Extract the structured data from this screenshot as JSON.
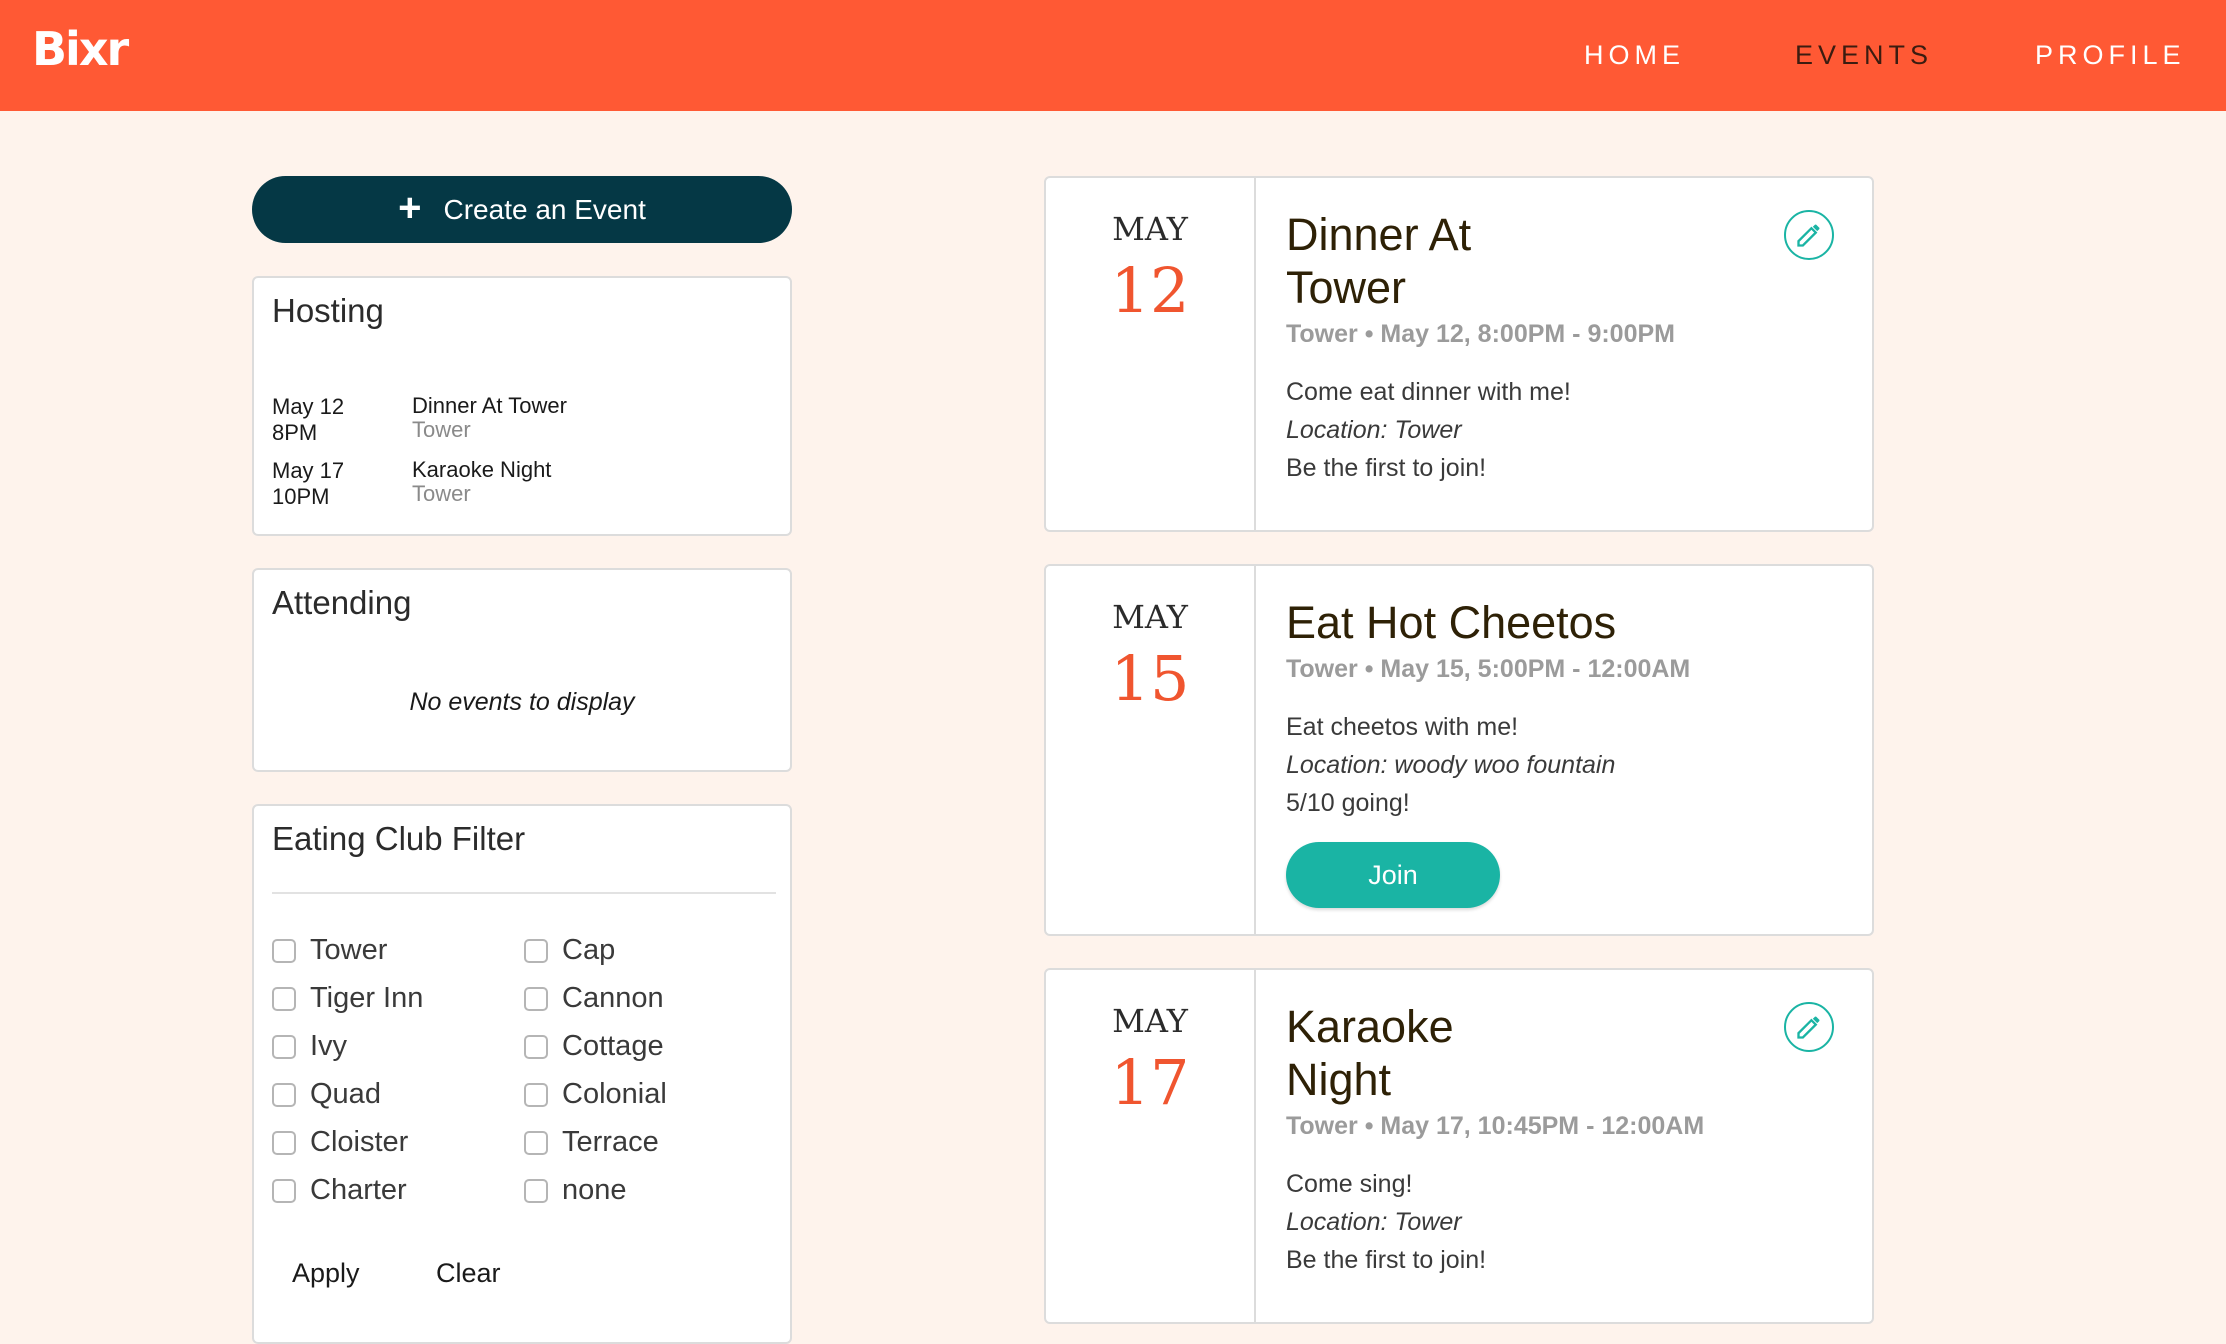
{
  "app": {
    "logo": "Bixr"
  },
  "nav": {
    "home": "HOME",
    "events": "EVENTS",
    "profile": "PROFILE",
    "active": "EVENTS"
  },
  "colors": {
    "header": "#ff5934",
    "primary_dark": "#053845",
    "accent_teal": "#1ab4a4",
    "day_number": "#f0552f",
    "background": "#fef3ec"
  },
  "sidebar": {
    "create_button": {
      "label": "Create an Event",
      "icon": "plus-icon"
    },
    "hosting": {
      "title": "Hosting",
      "items": [
        {
          "date": "May 12",
          "time": "8PM",
          "name": "Dinner At Tower",
          "location": "Tower"
        },
        {
          "date": "May 17",
          "time": "10PM",
          "name": "Karaoke Night",
          "location": "Tower"
        }
      ]
    },
    "attending": {
      "title": "Attending",
      "empty_text": "No events to display"
    },
    "filter": {
      "title": "Eating Club Filter",
      "options": [
        "Tower",
        "Cap",
        "Tiger Inn",
        "Cannon",
        "Ivy",
        "Cottage",
        "Quad",
        "Colonial",
        "Cloister",
        "Terrace",
        "Charter",
        "none"
      ],
      "apply_label": "Apply",
      "clear_label": "Clear"
    }
  },
  "events": [
    {
      "month": "MAY",
      "day": "12",
      "title_line1": "Dinner At",
      "title_line2": "Tower",
      "meta": "Tower • May 12, 8:00PM - 9:00PM",
      "description": "Come eat dinner with me!",
      "location": "Location: Tower",
      "status": "Be the first to join!",
      "editable": true,
      "icon": "pencil-icon"
    },
    {
      "month": "MAY",
      "day": "15",
      "title_line1": "Eat Hot Cheetos",
      "title_line2": "",
      "meta": "Tower • May 15, 5:00PM - 12:00AM",
      "description": "Eat cheetos with me!",
      "location": "Location: woody woo fountain",
      "status": "5/10 going!",
      "join_label": "Join"
    },
    {
      "month": "MAY",
      "day": "17",
      "title_line1": "Karaoke",
      "title_line2": "Night",
      "meta": "Tower • May 17, 10:45PM - 12:00AM",
      "description": "Come sing!",
      "location": "Location: Tower",
      "status": "Be the first to join!",
      "editable": true,
      "icon": "pencil-icon"
    }
  ]
}
